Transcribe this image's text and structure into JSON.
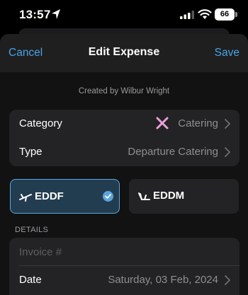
{
  "status": {
    "time": "13:57",
    "battery": "66"
  },
  "nav": {
    "cancel": "Cancel",
    "title": "Edit Expense",
    "save": "Save"
  },
  "created_by": "Created by Wilbur Wright",
  "fields": {
    "category": {
      "label": "Category",
      "value": "Catering",
      "icon": "catering-x-icon"
    },
    "type": {
      "label": "Type",
      "value": "Departure Catering"
    }
  },
  "airports": [
    {
      "code": "EDDF",
      "icon": "departure-plane-icon",
      "selected": true
    },
    {
      "code": "EDDM",
      "icon": "arrival-plane-icon",
      "selected": false
    }
  ],
  "details": {
    "section_label": "DETAILS",
    "invoice_placeholder": "Invoice #",
    "date_label": "Date",
    "date_value": "Saturday, 03 Feb, 2024"
  },
  "colors": {
    "accent": "#4aa3e8",
    "selected_bg": "#233d50",
    "catering_icon": "#e9a0d8"
  }
}
